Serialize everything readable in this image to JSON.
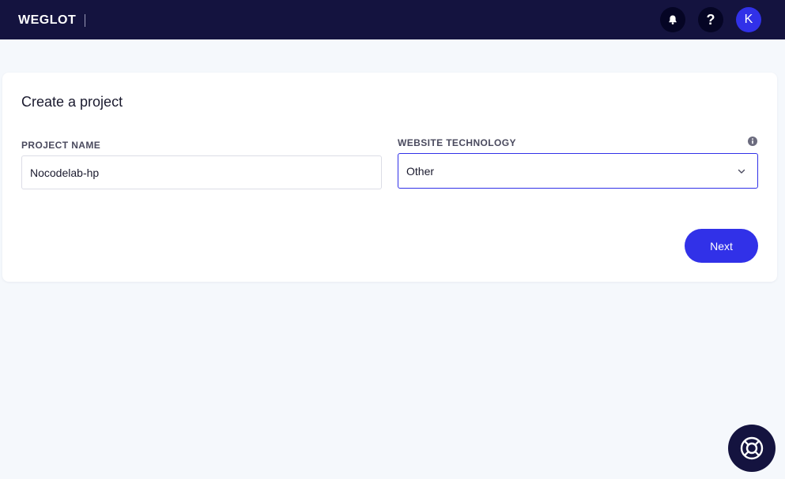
{
  "header": {
    "logo_text": "WEGLOT",
    "bell_icon": "bell-icon",
    "help_label": "?",
    "avatar_initial": "K"
  },
  "form": {
    "title": "Create a project",
    "project_name_label": "PROJECT NAME",
    "project_name_value": "Nocodelab-hp",
    "technology_label": "WEBSITE TECHNOLOGY",
    "technology_value": "Other",
    "info_icon": "info-icon",
    "next_label": "Next"
  },
  "support": {
    "icon": "lifebuoy-icon"
  },
  "colors": {
    "header_bg": "#14133f",
    "accent": "#3131e8",
    "page_bg": "#f5f8fc"
  }
}
